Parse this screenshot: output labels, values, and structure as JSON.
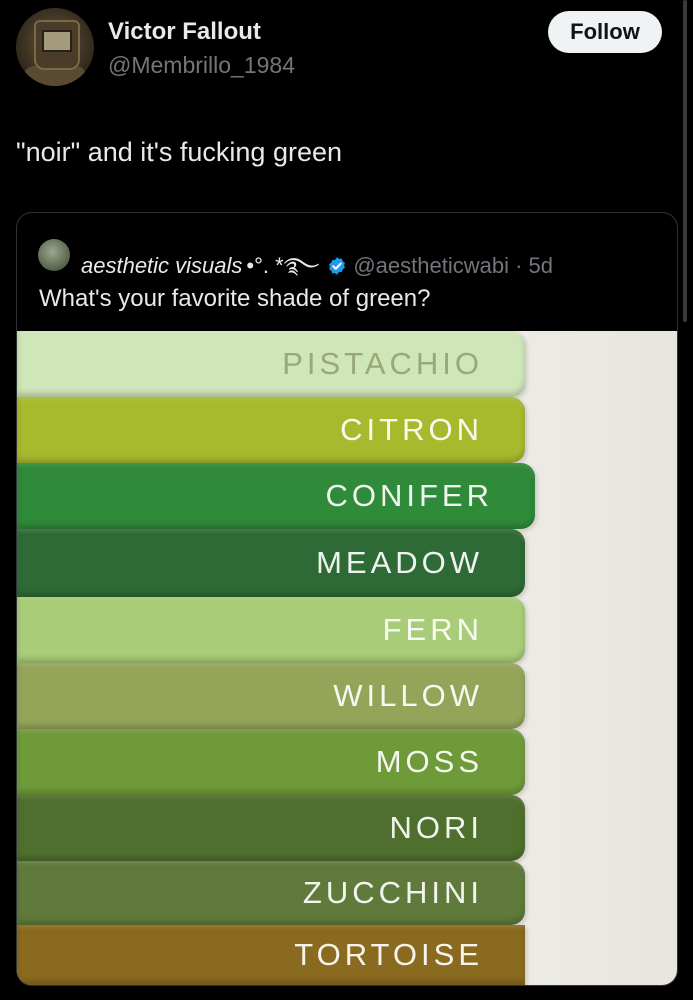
{
  "post": {
    "display_name": "Victor Fallout",
    "handle": "@Membrillo_1984",
    "follow_label": "Follow",
    "text": "\"noir\" and it's fucking green"
  },
  "quote": {
    "display_name": "aesthetic visuals",
    "name_decoration": "•°. *࿐",
    "handle": "@aestheticwabi",
    "separator": "·",
    "time": "5d",
    "text": "What's your favorite shade of green?",
    "verified_color": "#1d9bf0"
  },
  "swatches": [
    {
      "label": "PISTACHIO",
      "color": "#cfe6b8"
    },
    {
      "label": "CITRON",
      "color": "#a7ba2e"
    },
    {
      "label": "CONIFER",
      "color": "#2f8a3a"
    },
    {
      "label": "MEADOW",
      "color": "#2e6a35"
    },
    {
      "label": "FERN",
      "color": "#a8cc78"
    },
    {
      "label": "WILLOW",
      "color": "#94a55a"
    },
    {
      "label": "MOSS",
      "color": "#6f9a3a"
    },
    {
      "label": "NORI",
      "color": "#4f6f2e"
    },
    {
      "label": "ZUCCHINI",
      "color": "#5f7a3a"
    },
    {
      "label": "TORTOISE",
      "color": "#8a6a1e"
    }
  ],
  "theme": {
    "background": "#000000",
    "text_primary": "#e7e9ea",
    "text_secondary": "#71767b"
  }
}
